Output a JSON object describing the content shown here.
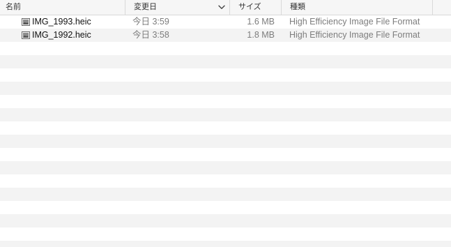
{
  "columns": {
    "name": "名前",
    "date_modified": "変更日",
    "size": "サイズ",
    "kind": "種類"
  },
  "files": [
    {
      "name": "IMG_1993.heic",
      "date_modified": "今日 3:59",
      "size": "1.6 MB",
      "kind": "High Efficiency Image File Format",
      "icon": "heic-image-file-icon"
    },
    {
      "name": "IMG_1992.heic",
      "date_modified": "今日 3:58",
      "size": "1.8 MB",
      "kind": "High Efficiency Image File Format",
      "icon": "heic-image-file-icon"
    }
  ],
  "sort": {
    "column": "date_modified",
    "direction": "descending",
    "icon": "chevron-down-icon"
  },
  "colors": {
    "header_bg": "#f6f6f6",
    "stripe": "#f3f3f3",
    "secondary_text": "#7d7d7d"
  }
}
